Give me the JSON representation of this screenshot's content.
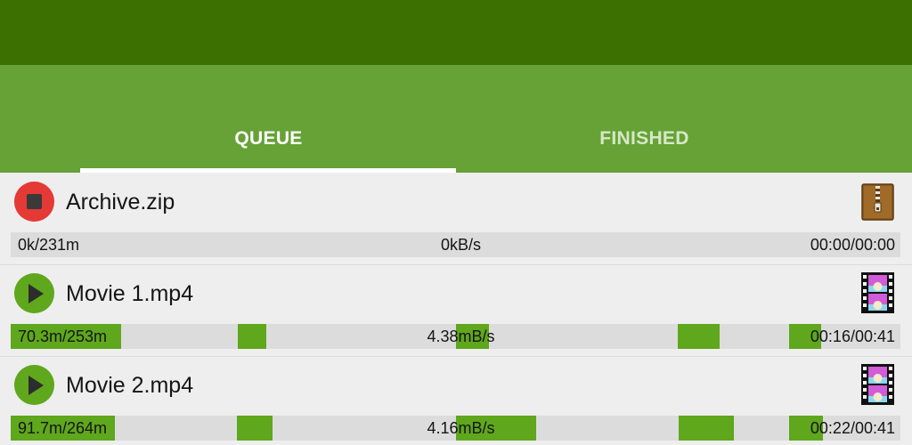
{
  "tabs": {
    "queue": "QUEUE",
    "finished": "FINISHED"
  },
  "downloads": [
    {
      "name": "Archive.zip",
      "state": "running",
      "control_icon": "stop-icon",
      "file_icon": "zip-archive-icon",
      "size_text": "0k/231m",
      "speed_text": "0kB/s",
      "time_text": "00:00/00:00"
    },
    {
      "name": "Movie 1.mp4",
      "state": "paused",
      "control_icon": "play-icon",
      "file_icon": "video-file-icon",
      "size_text": "70.3m/253m",
      "speed_text": "4.38mB/s",
      "time_text": "00:16/00:41"
    },
    {
      "name": "Movie 2.mp4",
      "state": "paused",
      "control_icon": "play-icon",
      "file_icon": "video-file-icon",
      "size_text": "91.7m/264m",
      "speed_text": "4.16mB/s",
      "time_text": "00:22/00:41"
    }
  ],
  "colors": {
    "status_bar": "#3c7001",
    "tab_bar": "#66a236",
    "progress_fill": "#5fa71c",
    "stop_button": "#e53935",
    "play_button": "#5fa71c"
  }
}
